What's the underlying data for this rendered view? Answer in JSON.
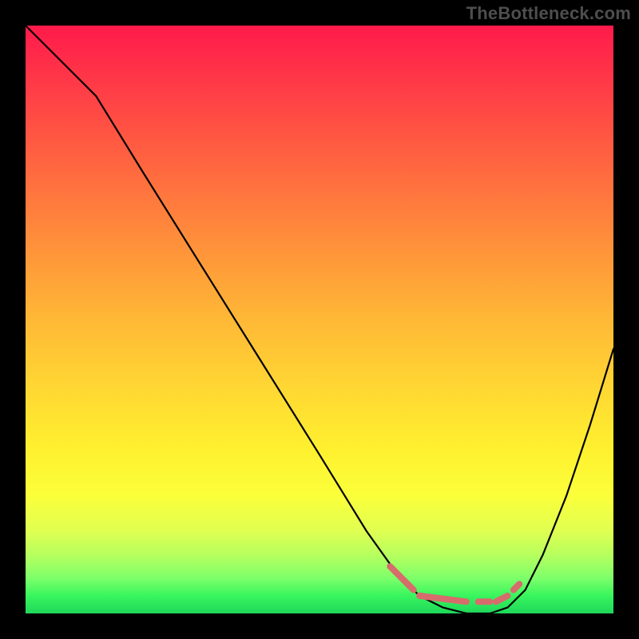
{
  "watermark": "TheBottleneck.com",
  "chart_data": {
    "type": "line",
    "title": "",
    "xlabel": "",
    "ylabel": "",
    "xlim": [
      0,
      100
    ],
    "ylim": [
      0,
      100
    ],
    "grid": false,
    "background_gradient": {
      "top": "#ff1a4b",
      "mid_upper": "#ff933a",
      "mid_lower": "#fff02f",
      "bottom": "#1fd85a"
    },
    "series": [
      {
        "name": "bottleneck-curve",
        "x": [
          0,
          4,
          8,
          12,
          20,
          30,
          40,
          50,
          58,
          63,
          67,
          71,
          75,
          79,
          82,
          85,
          88,
          92,
          96,
          100
        ],
        "values": [
          100,
          96,
          92,
          88,
          75,
          59,
          43,
          27,
          14,
          7,
          3,
          1,
          0,
          0,
          1,
          4,
          10,
          20,
          32,
          45
        ],
        "color": "#000000"
      }
    ],
    "highlight": {
      "name": "optimal-range-markers",
      "color": "#d66c6c",
      "segments": [
        {
          "x0": 62,
          "y0": 8,
          "x1": 66,
          "y1": 4
        },
        {
          "x0": 67,
          "y0": 3,
          "x1": 75,
          "y1": 2
        },
        {
          "x0": 77,
          "y0": 2,
          "x1": 79,
          "y1": 2
        },
        {
          "x0": 80,
          "y0": 2,
          "x1": 82,
          "y1": 3
        },
        {
          "x0": 83,
          "y0": 4,
          "x1": 84,
          "y1": 5
        }
      ]
    }
  }
}
